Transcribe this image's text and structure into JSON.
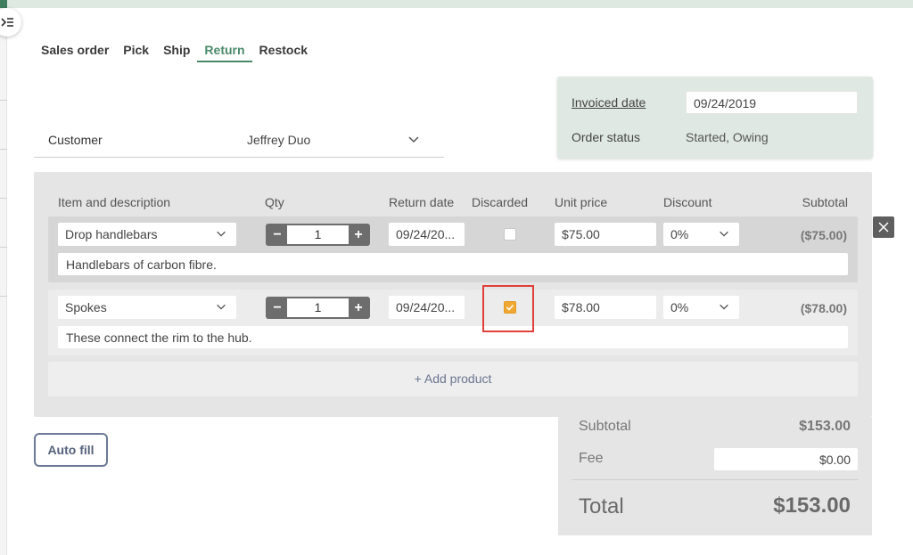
{
  "tabs": [
    "Sales order",
    "Pick",
    "Ship",
    "Return",
    "Restock"
  ],
  "active_tab": "Return",
  "customer": {
    "label": "Customer",
    "value": "Jeffrey Duo"
  },
  "invoice": {
    "invoiced_label": "Invoiced date",
    "invoiced_value": "09/24/2019",
    "status_label": "Order status",
    "status_value": "Started, Owing"
  },
  "columns": {
    "item": "Item and description",
    "qty": "Qty",
    "return_date": "Return date",
    "discarded": "Discarded",
    "unit_price": "Unit price",
    "discount": "Discount",
    "subtotal": "Subtotal"
  },
  "items": [
    {
      "name": "Drop handlebars",
      "qty": "1",
      "return_date": "09/24/20...",
      "discarded": false,
      "unit_price": "$75.00",
      "discount": "0%",
      "subtotal": "($75.00)",
      "description": "Handlebars of carbon fibre."
    },
    {
      "name": "Spokes",
      "qty": "1",
      "return_date": "09/24/20...",
      "discarded": true,
      "unit_price": "$78.00",
      "discount": "0%",
      "subtotal": "($78.00)",
      "description": "These connect the rim to the hub."
    }
  ],
  "add_product": "+ Add product",
  "auto_fill": "Auto fill",
  "totals": {
    "subtotal_label": "Subtotal",
    "subtotal_value": "$153.00",
    "fee_label": "Fee",
    "fee_value": "$0.00",
    "total_label": "Total",
    "total_value": "$153.00"
  },
  "colors": {
    "accent": "#4a8a6b",
    "checkbox_checked": "#f0a833",
    "highlight": "#e0403a"
  },
  "icons": {
    "menu_toggle": "sidebar-toggle-icon",
    "close": "close-icon",
    "chevron": "chevron-down-icon",
    "check": "check-icon"
  }
}
